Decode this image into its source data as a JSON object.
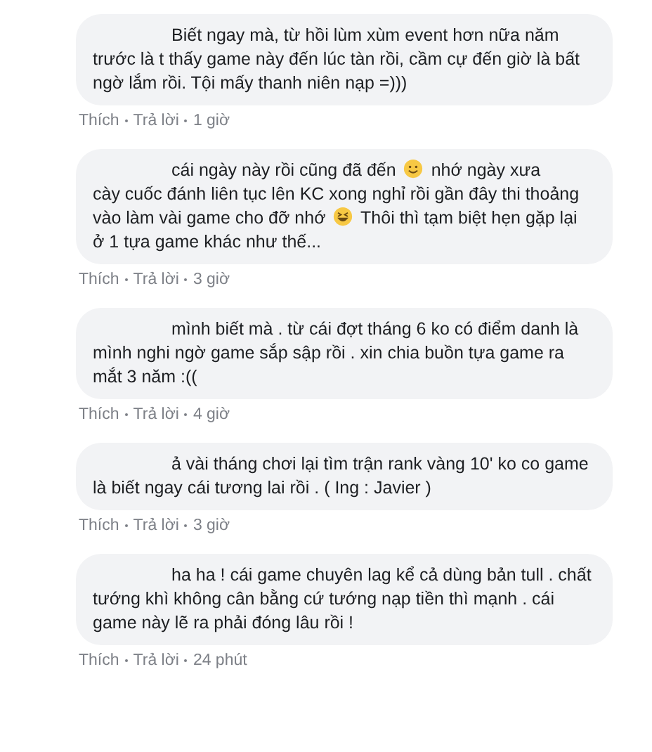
{
  "comments": [
    {
      "body": [
        {
          "kind": "text",
          "text": "Biết ngay mà, từ hồi lùm xùm event hơn nữa năm trước là t thấy game này đến lúc tàn rồi, cầm cự đến giờ là bất ngờ lắm rồi. Tội mấy thanh niên nạp =)))"
        }
      ],
      "like": "Thích",
      "reply": "Trả lời",
      "time": "1 giờ"
    },
    {
      "body": [
        {
          "kind": "line",
          "text": "cái ngày này rồi cũng đã đến"
        },
        {
          "kind": "smile"
        },
        {
          "kind": "line",
          "text": "nhớ ngày xưa"
        },
        {
          "kind": "line",
          "text": "cày cuốc đánh liên tục lên KC xong nghỉ rồi gần đây thi thoảng"
        },
        {
          "kind": "line",
          "text": "vào làm vài game cho đỡ nhớ"
        },
        {
          "kind": "grin"
        },
        {
          "kind": "line",
          "text": "Thôi thì tạm biệt hẹn gặp lại"
        },
        {
          "kind": "line",
          "text": "ở 1 tựa game khác như thế..."
        }
      ],
      "like": "Thích",
      "reply": "Trả lời",
      "time": "3 giờ"
    },
    {
      "body": [
        {
          "kind": "text",
          "text": "mình biết mà . từ cái đợt tháng 6 ko có điểm danh là mình nghi ngờ game sắp sập rồi . xin chia buồn tựa game ra mắt 3 năm :(("
        }
      ],
      "like": "Thích",
      "reply": "Trả lời",
      "time": "4 giờ"
    },
    {
      "body": [
        {
          "kind": "text",
          "text": "ả vài tháng chơi lại tìm trận rank vàng 10' ko co game là biết ngay cái tương lai rồi . ( Ing : Javier )"
        }
      ],
      "like": "Thích",
      "reply": "Trả lời",
      "time": "3 giờ"
    },
    {
      "body": [
        {
          "kind": "text",
          "text": "ha ha ! cái game chuyên lag kể cả dùng bản tull . chất tướng khì không cân bằng cứ tướng nạp tiền thì mạnh . cái game này lẽ ra phải đóng lâu rồi !"
        }
      ],
      "like": "Thích",
      "reply": "Trả lời",
      "time": "24 phút"
    }
  ]
}
